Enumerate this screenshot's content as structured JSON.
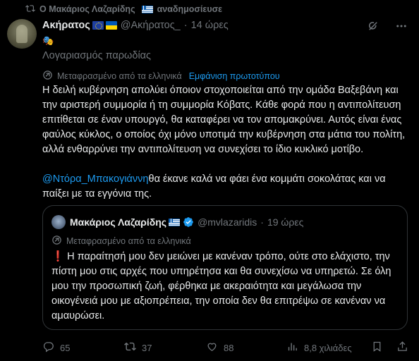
{
  "repost": {
    "text": "Ο Μακάριος Λαζαρίδης",
    "suffix": "αναδημοσίευσε"
  },
  "tweet": {
    "name": "Ακήρατος",
    "handle": "@Ακήρατος_",
    "dot": "·",
    "time": "14 ώρες",
    "mask": "🎭",
    "parody_label": "Λογαριασμός παρωδίας",
    "translated_label": "Μεταφρασμένο από τα ελληνικά",
    "show_original": "Εμφάνιση πρωτοτύπου",
    "paragraph1": "Η δειλή κυβέρνηση απολύει όποιον στοχοποιείται από την ομάδα Βαξεβάνη και την αριστερή συμμορία ή τη συμμορία Κόβατς. Κάθε φορά που η αντιπολίτευση επιτίθεται σε έναν υπουργό, θα καταφέρει να τον απομακρύνει. Αυτός είναι ένας φαύλος κύκλος, ο οποίος όχι μόνο υποτιμά την κυβέρνηση στα μάτια του πολίτη, αλλά ενθαρρύνει την αντιπολίτευση να συνεχίσει το ίδιο κυκλικό μοτίβο.",
    "mention": "@Ντόρα_Μπακογιάννη",
    "paragraph2_rest": "θα έκανε καλά να φάει ένα κομμάτι σοκολάτας και να παίξει με τα εγγόνια της."
  },
  "quote": {
    "name": "Μακάριος Λαζαρίδης",
    "handle": "@mvlazaridis",
    "dot": "·",
    "time": "19 ώρες",
    "translated_label": "Μεταφρασμένο από τα ελληνικά",
    "bang": "❗",
    "text": "Η παραίτησή μου δεν μειώνει με κανέναν τρόπο, ούτε στο ελάχιστο, την πίστη μου στις αρχές που υπηρέτησα και θα συνεχίσω να υπηρετώ. Σε όλη μου την προσωπική ζωή, φέρθηκα με ακεραιότητα και μεγάλωσα την οικογένειά μου με αξιοπρέπεια, την οποία δεν θα επιτρέψω σε κανέναν να αμαυρώσει."
  },
  "actions": {
    "replies": "65",
    "reposts": "37",
    "likes": "88",
    "views": "8,8 χιλιάδες"
  },
  "colors": {
    "accent": "#1d9bf0",
    "muted": "#71767b",
    "text": "#e7e9ea",
    "border": "#2f3336"
  },
  "icons": [
    "repost-icon",
    "grok-icon",
    "more-icon",
    "translate-icon",
    "verified-icon",
    "reply-icon",
    "like-icon",
    "views-icon",
    "bookmark-icon",
    "share-icon"
  ]
}
